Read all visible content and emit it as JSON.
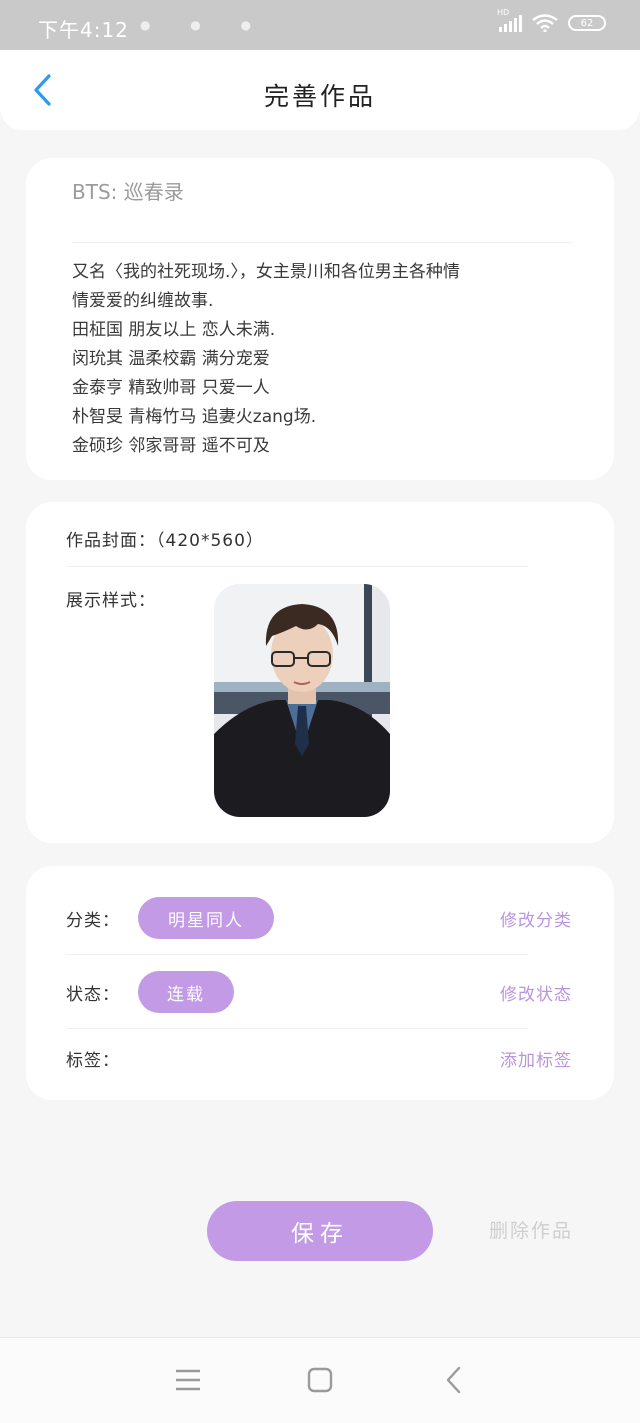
{
  "status_bar": {
    "time": "下午4:12",
    "battery": "62",
    "network_label": "HD"
  },
  "header": {
    "title": "完善作品"
  },
  "work": {
    "title": "BTS: 巡春录",
    "description_lines": [
      "又名〈我的社死现场.〉，女主景川和各位男主各种情",
      "情爱爱的纠缠故事.",
      "田柾国 朋友以上 恋人未满.",
      "闵玧其 温柔校霸 满分宠爱",
      "金泰亨 精致帅哥 只爱一人",
      "朴智旻 青梅竹马 追妻火zang场.",
      "金硕珍 邻家哥哥 遥不可及"
    ]
  },
  "cover": {
    "label": "作品封面：（420*560）",
    "style_label": "展示样式："
  },
  "meta": {
    "category_label": "分类：",
    "category_value": "明星同人",
    "category_action": "修改分类",
    "status_label": "状态：",
    "status_value": "连载",
    "status_action": "修改状态",
    "tags_label": "标签：",
    "tags_action": "添加标签"
  },
  "actions": {
    "save": "保存",
    "delete": "删除作品"
  },
  "colors": {
    "accent": "#c29ae6",
    "link": "#b995de",
    "back_arrow": "#2a9bf0"
  },
  "icons": {
    "back": "chevron-left-icon",
    "menu": "menu-icon",
    "home": "home-square-icon",
    "nav_back": "nav-back-icon"
  }
}
